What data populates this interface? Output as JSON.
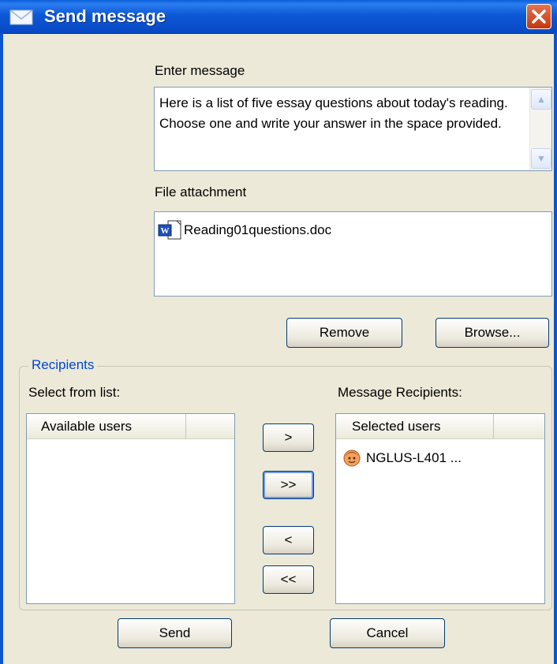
{
  "window": {
    "title": "Send message",
    "close_label": "✕"
  },
  "message": {
    "label": "Enter message",
    "text": "Here is a list of five essay questions about today's reading. Choose one and write your answer in the space provided."
  },
  "attachment": {
    "label": "File attachment",
    "files": [
      "Reading01questions.doc"
    ]
  },
  "attachment_buttons": {
    "remove": "Remove",
    "browse": "Browse..."
  },
  "recipients": {
    "group_label": "Recipients",
    "select_label": "Select from list:",
    "message_recipients_label": "Message Recipients:",
    "available_header": "Available users",
    "selected_header": "Selected users",
    "available_users": [],
    "selected_users": [
      "NGLUS-L401 ..."
    ]
  },
  "transfer_buttons": {
    "add": ">",
    "add_all": ">>",
    "remove": "<",
    "remove_all": "<<"
  },
  "footer": {
    "send": "Send",
    "cancel": "Cancel"
  },
  "colors": {
    "titlebar": "#0a4ecb",
    "group_label": "#0046d5",
    "background": "#ece9d8"
  }
}
